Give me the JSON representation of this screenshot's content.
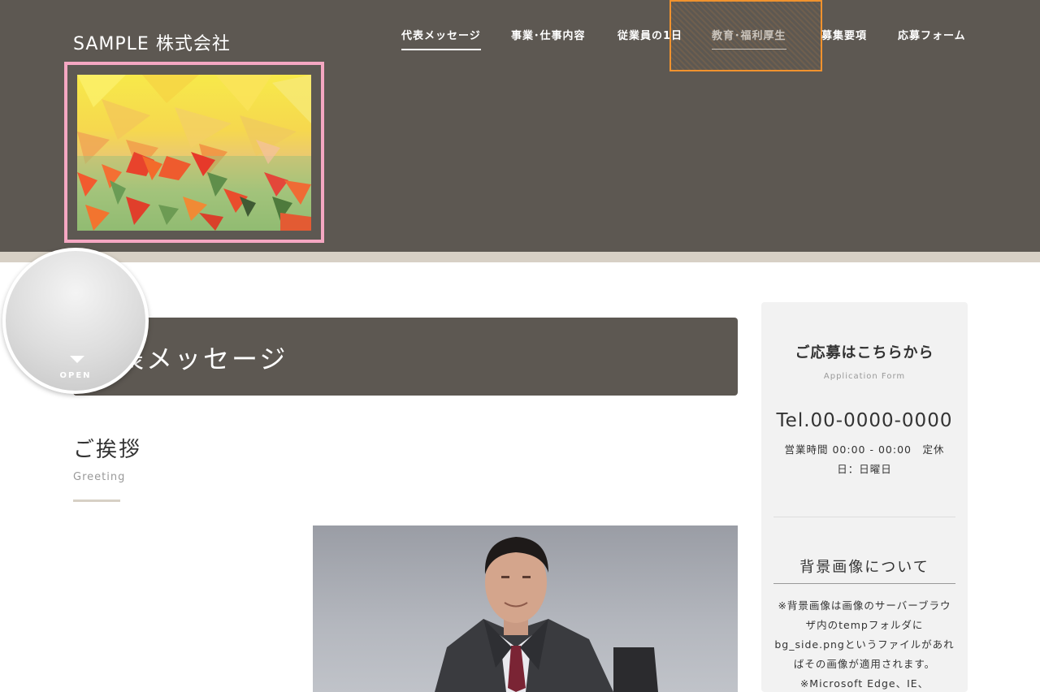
{
  "header": {
    "logo": "SAMPLE 株式会社",
    "nav": [
      {
        "label": "代表メッセージ",
        "state": "active"
      },
      {
        "label": "事業･仕事内容",
        "state": "normal"
      },
      {
        "label": "従業員の1日",
        "state": "normal"
      },
      {
        "label": "教育･福利厚生",
        "state": "hover"
      },
      {
        "label": "募集要項",
        "state": "normal"
      },
      {
        "label": "応募フォーム",
        "state": "normal"
      }
    ]
  },
  "open_button": {
    "label": "OPEN"
  },
  "main": {
    "page_title": "代表メッセージ",
    "section_title": "ご挨拶",
    "section_sub": "Greeting"
  },
  "sidebar": {
    "title": "ご応募はこちらから",
    "subtitle": "Application Form",
    "tel": "Tel.00-0000-0000",
    "hours": "営業時間 00:00 - 00:00　定休日：日曜日",
    "bg_title": "背景画像について",
    "bg_note": "※背景画像は画像のサーバーブラウザ内のtempフォルダにbg_side.pngというファイルがあればその画像が適用されます。※Microsoft Edge、IE、"
  },
  "colors": {
    "header_bg": "#5d5852",
    "accent_strip": "#d7d0c5",
    "hero_frame": "#f5a7c2",
    "hover_highlight": "#f0922e",
    "sidebar_bg": "#f2f2f2"
  }
}
